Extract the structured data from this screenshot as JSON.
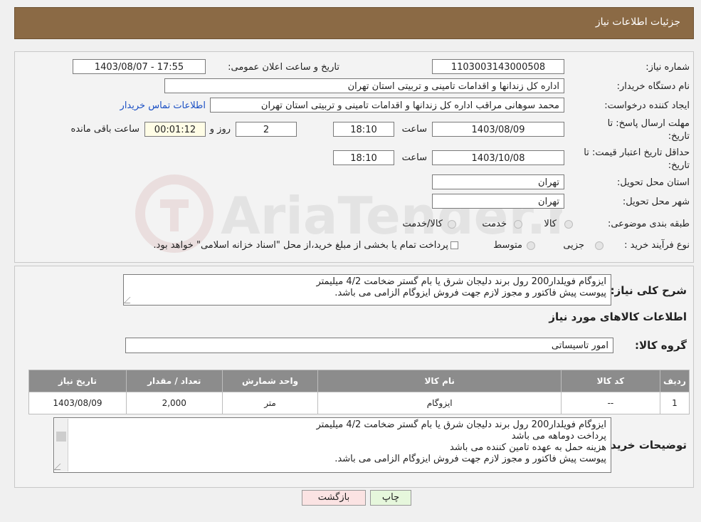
{
  "header": {
    "title": "جزئیات اطلاعات نیاز"
  },
  "form": {
    "need_number_label": "شماره نیاز:",
    "need_number": "1103003143000508",
    "announce_label": "تاریخ و ساعت اعلان عمومی:",
    "announce_value": "1403/08/07 - 17:55",
    "buyer_org_label": "نام دستگاه خریدار:",
    "buyer_org": "اداره کل زندانها و اقدامات تامینی و تربیتی استان تهران",
    "creator_label": "ایجاد کننده درخواست:",
    "creator": "محمد سوهانی مراقب  اداره کل زندانها و اقدامات تامینی و تربیتی استان تهران",
    "contact_link": "اطلاعات تماس خریدار",
    "reply_deadline_label_1": "مهلت ارسال پاسخ: تا",
    "reply_deadline_label_2": "تاریخ:",
    "reply_date": "1403/08/09",
    "time_label": "ساعت",
    "reply_time": "18:10",
    "days": "2",
    "day_and_label": "روز و",
    "remaining": "00:01:12",
    "remaining_label": "ساعت باقی مانده",
    "price_validity_label_1": "حداقل تاریخ اعتبار قیمت: تا",
    "price_validity_label_2": "تاریخ:",
    "price_date": "1403/10/08",
    "price_time": "18:10",
    "province_label": "استان محل تحویل:",
    "province": "تهران",
    "city_label": "شهر محل تحویل:",
    "city": "تهران",
    "category_label": "طبقه بندی موضوعی:",
    "category_options": [
      "کالا",
      "خدمت",
      "کالا/خدمت"
    ],
    "process_label": "نوع فرآیند خرید :",
    "process_options": [
      "جزیی",
      "متوسط"
    ],
    "process_note": "پرداخت تمام یا بخشی از مبلغ خرید،از محل \"اسناد خزانه اسلامی\" خواهد بود."
  },
  "description": {
    "label": "شرح کلی نیاز:",
    "lines": [
      "ایزوگام فویلدار200 رول برند دلیجان شرق یا بام گستر ضخامت 4/2 میلیمتر",
      "پیوست پیش فاکتور و مجوز لازم جهت فروش ایزوگام الزامی می باشد."
    ],
    "items_title": "اطلاعات کالاهای مورد نیاز",
    "group_label": "گروه کالا:",
    "group_value": "امور تاسیساتی"
  },
  "table": {
    "headers": [
      "ردیف",
      "کد کالا",
      "نام کالا",
      "واحد شمارش",
      "تعداد / مقدار",
      "تاریخ نیاز"
    ],
    "rows": [
      [
        "1",
        "--",
        "ایزوگام",
        "متر",
        "2,000",
        "1403/08/09"
      ]
    ]
  },
  "buyer_notes": {
    "label": "توضیحات خریدار:",
    "lines": [
      "ایزوگام فویلدار200 رول برند دلیجان شرق یا بام گستر ضخامت 4/2 میلیمتر",
      "پرداخت دوماهه می باشد",
      "هزینه حمل به عهده تامین کننده می باشد",
      "پیوست پیش فاکتور و مجوز لازم جهت فروش ایزوگام الزامی می باشد."
    ]
  },
  "buttons": {
    "print": "چاپ",
    "back": "بازگشت"
  },
  "watermark": {
    "text": "AriaTender.neT"
  },
  "colors": {
    "header": "#8b6a45",
    "table_header": "#8c8c8c",
    "link": "#1a4fc4",
    "print_btn": "#e6f7dc",
    "back_btn": "#fbe3e3"
  }
}
